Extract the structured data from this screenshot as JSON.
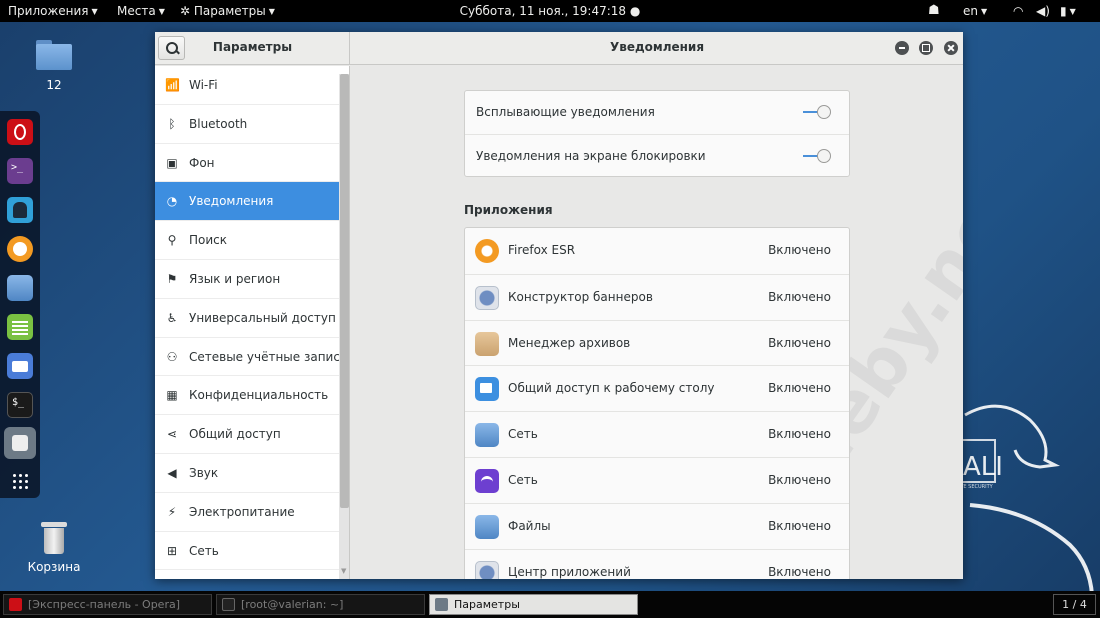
{
  "topbar": {
    "apps_label": "Приложения",
    "places_label": "Места",
    "settings_label": "Параметры",
    "clock": "Суббота, 11 ноя., 19:47:18",
    "lang": "en"
  },
  "desktop": {
    "folder_label": "12",
    "trash_label": "Корзина"
  },
  "window": {
    "sidebar_title": "Параметры",
    "panel_title": "Уведомления"
  },
  "sidebar": {
    "items": [
      {
        "label": "Wi-Fi",
        "icon": "wifi-icon",
        "glyph": "📶"
      },
      {
        "label": "Bluetooth",
        "icon": "bluetooth-icon",
        "glyph": "ᛒ"
      },
      {
        "label": "Фон",
        "icon": "background-icon",
        "glyph": "▣"
      },
      {
        "label": "Уведомления",
        "icon": "notifications-icon",
        "glyph": "◔",
        "active": true
      },
      {
        "label": "Поиск",
        "icon": "search-icon",
        "glyph": "⚲"
      },
      {
        "label": "Язык и регион",
        "icon": "region-icon",
        "glyph": "⚑"
      },
      {
        "label": "Универсальный доступ",
        "icon": "accessibility-icon",
        "glyph": "♿"
      },
      {
        "label": "Сетевые учётные записи",
        "icon": "online-accounts-icon",
        "glyph": "⚇"
      },
      {
        "label": "Конфиденциальность",
        "icon": "privacy-icon",
        "glyph": "▦"
      },
      {
        "label": "Общий доступ",
        "icon": "share-icon",
        "glyph": "⋖"
      },
      {
        "label": "Звук",
        "icon": "sound-icon",
        "glyph": "◀"
      },
      {
        "label": "Электропитание",
        "icon": "power-icon",
        "glyph": "⚡"
      },
      {
        "label": "Сеть",
        "icon": "network-icon",
        "glyph": "⊞"
      }
    ]
  },
  "notifications": {
    "toggles": [
      {
        "label": "Всплывающие уведомления"
      },
      {
        "label": "Уведомления на экране блокировки"
      }
    ],
    "apps_header": "Приложения",
    "apps": [
      {
        "name": "Firefox ESR",
        "status": "Включено",
        "icon": "firefox-icon"
      },
      {
        "name": "Конструктор баннеров",
        "status": "Включено",
        "icon": "banner-designer-icon"
      },
      {
        "name": "Менеджер архивов",
        "status": "Включено",
        "icon": "archive-manager-icon"
      },
      {
        "name": "Общий доступ к рабочему столу",
        "status": "Включено",
        "icon": "desktop-sharing-icon"
      },
      {
        "name": "Сеть",
        "status": "Включено",
        "icon": "network-folder-icon"
      },
      {
        "name": "Сеть",
        "status": "Включено",
        "icon": "network-wifi-icon"
      },
      {
        "name": "Файлы",
        "status": "Включено",
        "icon": "files-icon"
      },
      {
        "name": "Центр приложений",
        "status": "Включено",
        "icon": "software-center-icon"
      }
    ]
  },
  "watermark": "Codeby.net",
  "taskbar": {
    "tasks": [
      {
        "label": "[Экспресс-панель - Opera]"
      },
      {
        "label": "[root@valerian: ~]"
      },
      {
        "label": "Параметры"
      }
    ],
    "workspace": "1 / 4"
  },
  "colors": {
    "accent": "#3d8ee0",
    "desktop_bg": "#245a92",
    "topbar_bg": "#000000"
  }
}
